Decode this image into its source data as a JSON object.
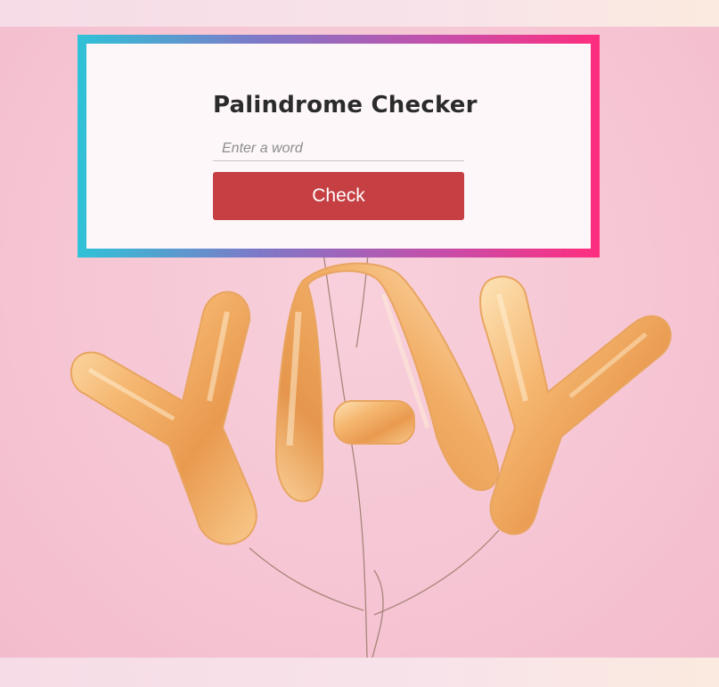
{
  "app": {
    "title": "Palindrome Checker"
  },
  "form": {
    "input_placeholder": "Enter a word",
    "input_value": "",
    "check_label": "Check"
  },
  "background": {
    "image": "yay-balloons-photo"
  },
  "colors": {
    "frame_gradient": [
      "#2fc2d7",
      "#7f78c8",
      "#c64eaa",
      "#ff2d7e"
    ],
    "button": "#c53f43",
    "card": "#fdf7fa",
    "scene": "#f6c6d4"
  }
}
